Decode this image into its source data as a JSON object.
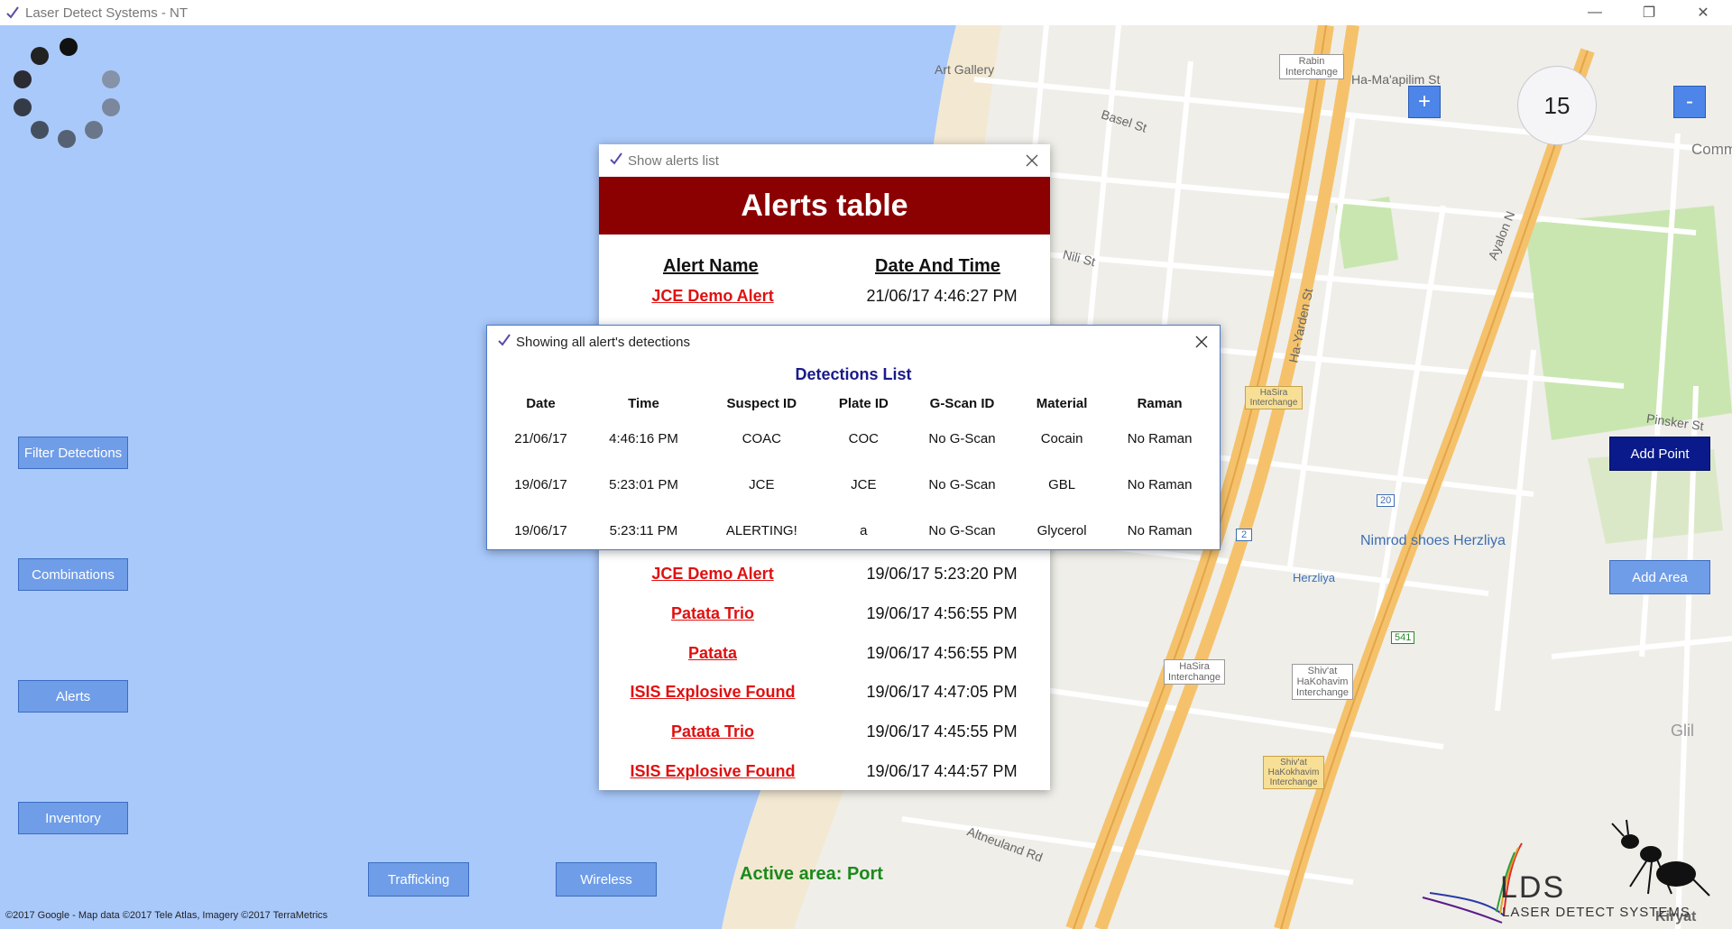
{
  "window": {
    "title": "Laser Detect Systems - NT",
    "controls": {
      "minimize": "—",
      "maximize": "❐",
      "close": "✕"
    }
  },
  "sidebar": {
    "buttons": [
      "Filter Detections",
      "Combinations",
      "Alerts",
      "Inventory"
    ]
  },
  "bottom_buttons": [
    "Trafficking",
    "Wireless"
  ],
  "active_area": "Active area: Port",
  "map": {
    "zoom_level": "15",
    "zoom_in": "+",
    "zoom_out": "-",
    "add_point": "Add Point",
    "add_area": "Add Area",
    "copyright": "©2017 Google - Map data ©2017 Tele Atlas, Imagery ©2017 TerraMetrics",
    "labels": [
      "Art Gallery",
      "Rabin Interchange",
      "Ha-Ma'apilim St",
      "Basel St",
      "Nili St",
      "Ha-Yarden St",
      "HaSira Interchange",
      "Pinsker St",
      "Nimrod shoes Herzliya",
      "Herzliya",
      "Shiv'at HaKohavim Interchange",
      "Altneuland Rd",
      "Ayalon N",
      "Glil",
      "Kiryat",
      "Comm",
      "HaSira Interchange",
      "Shiv'at HaKokhavim Interchange",
      "20",
      "2",
      "541"
    ],
    "colors": {
      "sea": "#a9c9fb",
      "land": "#efeee9",
      "highway": "#f5c26b",
      "road": "#ffffff",
      "park": "#c9e6b0"
    }
  },
  "alerts_dialog": {
    "window_title": "Show alerts list",
    "header": "Alerts table",
    "col_name": "Alert Name",
    "col_time": "Date And Time",
    "rows": [
      {
        "name": "JCE Demo Alert",
        "time": "21/06/17 4:46:27 PM"
      },
      {
        "name": "JCE Demo Alert",
        "time": "19/06/17 5:23:20 PM"
      },
      {
        "name": "Patata Trio",
        "time": "19/06/17 4:56:55 PM"
      },
      {
        "name": "Patata",
        "time": "19/06/17 4:56:55 PM"
      },
      {
        "name": "ISIS Explosive Found",
        "time": "19/06/17 4:47:05 PM"
      },
      {
        "name": "Patata Trio",
        "time": "19/06/17 4:45:55 PM"
      },
      {
        "name": "ISIS Explosive Found",
        "time": "19/06/17 4:44:57 PM"
      }
    ]
  },
  "detections_dialog": {
    "window_title": "Showing all alert's detections",
    "heading": "Detections List",
    "columns": [
      "Date",
      "Time",
      "Suspect ID",
      "Plate ID",
      "G-Scan ID",
      "Material",
      "Raman"
    ],
    "rows": [
      [
        "21/06/17",
        "4:46:16 PM",
        "COAC",
        "COC",
        "No G-Scan",
        "Cocain",
        "No Raman"
      ],
      [
        "19/06/17",
        "5:23:01 PM",
        "JCE",
        "JCE",
        "No G-Scan",
        "GBL",
        "No Raman"
      ],
      [
        "19/06/17",
        "5:23:11 PM",
        "ALERTING!",
        "a",
        "No G-Scan",
        "Glycerol",
        "No Raman"
      ]
    ]
  },
  "logo": {
    "title": "LDS",
    "subtitle": "LASER DETECT SYSTEMS"
  }
}
